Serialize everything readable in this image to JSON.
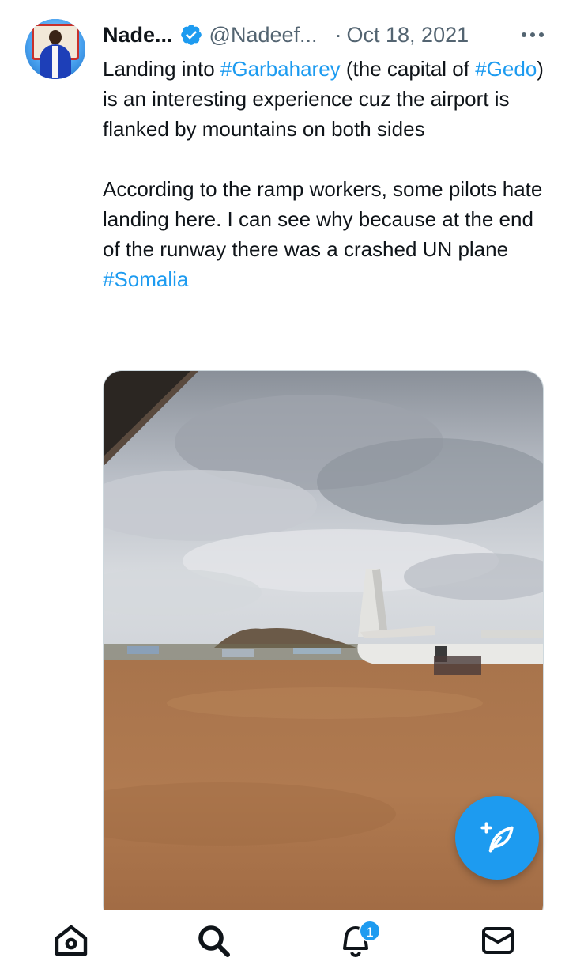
{
  "tweet": {
    "author_name": "Nade...",
    "author_handle": "@Nadeef...",
    "separator": "·",
    "date": "Oct 18, 2021",
    "paragraph1": [
      {
        "text": "Landing into ",
        "hashtag": false
      },
      {
        "text": "#Garbaharey",
        "hashtag": true
      },
      {
        "text": " (the capital of ",
        "hashtag": false
      },
      {
        "text": "#Gedo",
        "hashtag": true
      },
      {
        "text": ") is an interesting experience cuz the airport is flanked by mountains on both sides",
        "hashtag": false
      }
    ],
    "paragraph2": "According to the ramp workers, some pilots hate landing here. I can see why because at the end of the runway there was a crashed UN plane",
    "paragraph3_hashtag": "#Somalia",
    "media_alt": "",
    "verified_icon": "verified-badge-icon",
    "more_icon": "more-options-icon"
  },
  "colors": {
    "accent": "#1d9bf0",
    "text": "#0f1419",
    "muted": "#536471"
  },
  "compose_button": {
    "icon": "compose-feather-plus-icon"
  },
  "bottom_nav": {
    "items": [
      {
        "name": "home",
        "icon": "home-icon"
      },
      {
        "name": "search",
        "icon": "search-icon"
      },
      {
        "name": "notifications",
        "icon": "bell-icon",
        "badge": "1"
      },
      {
        "name": "messages",
        "icon": "envelope-icon"
      }
    ]
  }
}
